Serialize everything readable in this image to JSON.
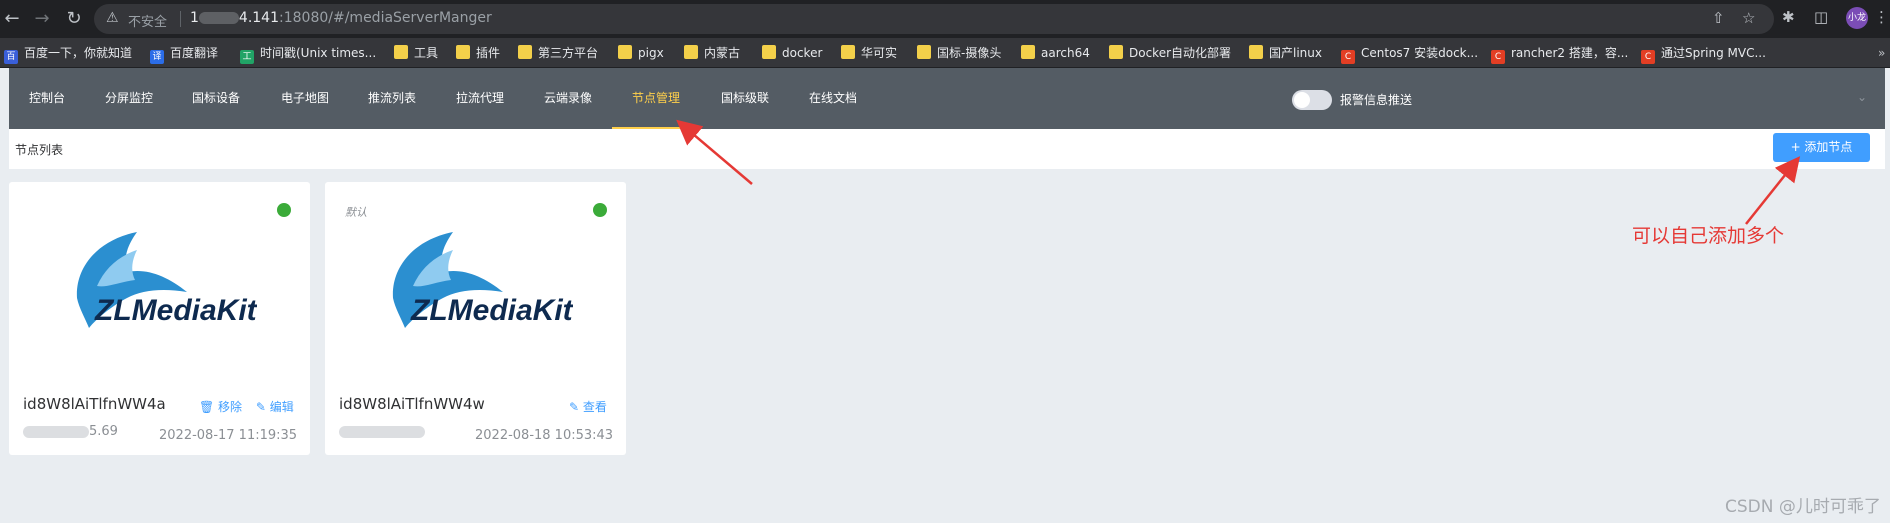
{
  "browser": {
    "insecure_label": "不安全",
    "url_prefix": "1",
    "url_host_end": "4.141",
    "url_rest": ":18080/#/mediaServerManger",
    "avatar_label": "小龙"
  },
  "bookmarks": [
    {
      "label": "百度一下，你就知道",
      "icon": "baidu-icon"
    },
    {
      "label": "百度翻译",
      "icon": "translate-icon"
    },
    {
      "label": "时间戳(Unix times...",
      "icon": "timestamp-icon"
    },
    {
      "label": "工具",
      "icon": "folder-icon"
    },
    {
      "label": "插件",
      "icon": "folder-icon"
    },
    {
      "label": "第三方平台",
      "icon": "folder-icon"
    },
    {
      "label": "pigx",
      "icon": "folder-icon"
    },
    {
      "label": "内蒙古",
      "icon": "folder-icon"
    },
    {
      "label": "docker",
      "icon": "folder-icon"
    },
    {
      "label": "华可实",
      "icon": "folder-icon"
    },
    {
      "label": "国标-摄像头",
      "icon": "folder-icon"
    },
    {
      "label": "aarch64",
      "icon": "folder-icon"
    },
    {
      "label": "Docker自动化部署",
      "icon": "folder-icon"
    },
    {
      "label": "国产linux",
      "icon": "folder-icon"
    },
    {
      "label": "Centos7 安装dock...",
      "icon": "csdn-icon"
    },
    {
      "label": "rancher2 搭建，容...",
      "icon": "csdn-icon"
    },
    {
      "label": "通过Spring MVC...",
      "icon": "csdn-icon"
    }
  ],
  "nav": {
    "items": [
      "控制台",
      "分屏监控",
      "国标设备",
      "电子地图",
      "推流列表",
      "拉流代理",
      "云端录像",
      "节点管理",
      "国标级联",
      "在线文档"
    ],
    "active_index": 7,
    "alarm_toggle_label": "报警信息推送",
    "alarm_toggle_on": false
  },
  "page": {
    "title": "节点列表",
    "add_button": "+ 添加节点"
  },
  "nodes": [
    {
      "id": "id8W8lAiTlfnWW4a",
      "ip_suffix": "5.69",
      "date": "2022-08-17 11:19:35",
      "default_label": "",
      "action1": "🗑 移除",
      "action2": "✎ 编辑",
      "status": "online",
      "logo_text": "ZLMediaKit"
    },
    {
      "id": "id8W8lAiTlfnWW4w",
      "ip_suffix": "",
      "date": "2022-08-18 10:53:43",
      "default_label": "默认",
      "action1": "",
      "action2": "✎ 查看",
      "status": "online",
      "logo_text": "ZLMediaKit"
    }
  ],
  "annotation": "可以自己添加多个",
  "watermark": "CSDN @儿时可乖了",
  "colors": {
    "nav_bg": "#545c64",
    "nav_active": "#ffd04b",
    "primary": "#409eff",
    "online": "#3bab39",
    "annotation": "#e53935"
  }
}
